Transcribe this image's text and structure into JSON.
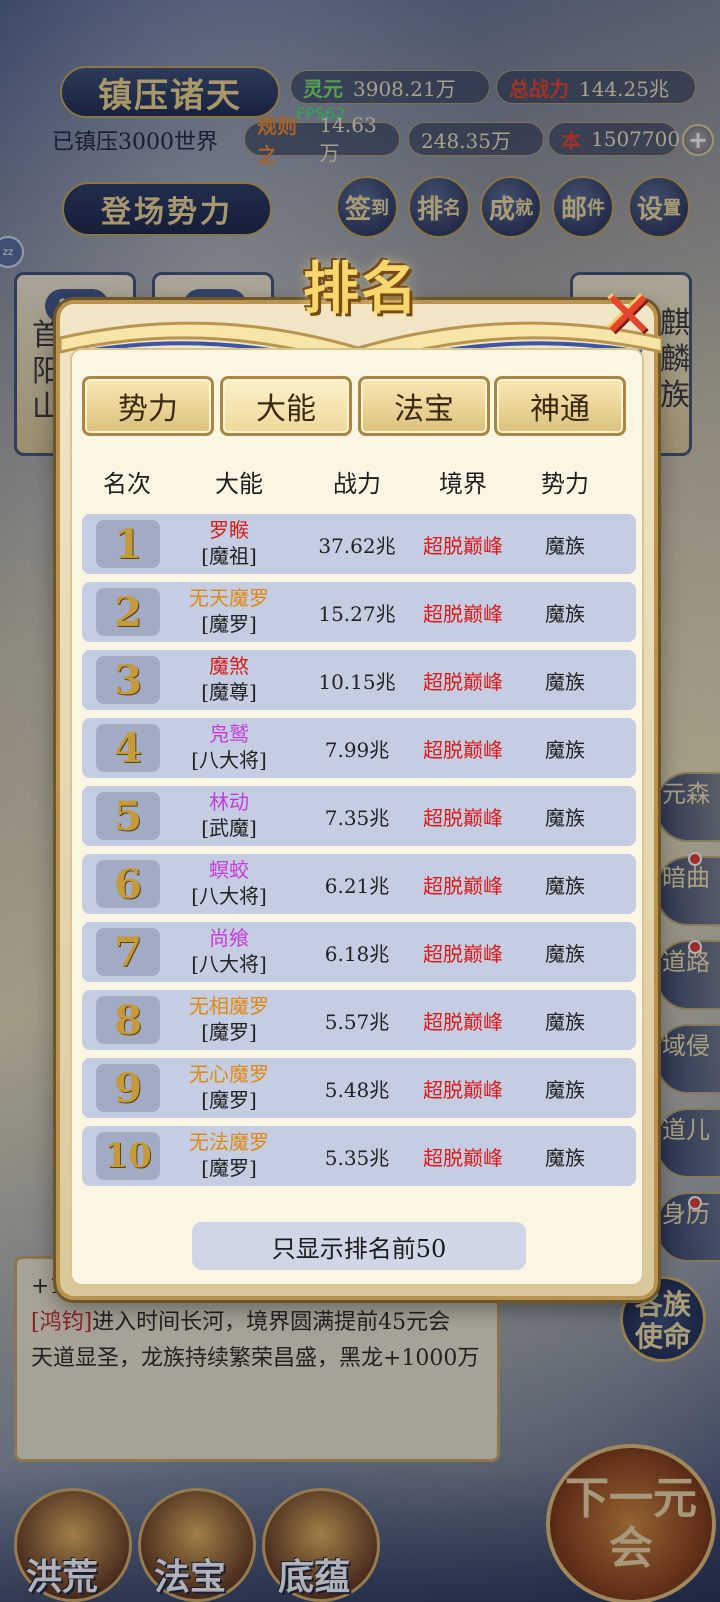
{
  "hud": {
    "title": "镇压诸天",
    "conquered": "已镇压3000世界",
    "fps": "FPS62",
    "spirit_label": "灵元",
    "spirit_value": "3908.21万",
    "total_power_label": "总战力",
    "total_power_value": "144.25兆",
    "rule_label": "规则之",
    "rule_value": "14.63万",
    "res2_value": "248.35万",
    "res3_label": "本",
    "res3_value": "1507700",
    "enter_label": "登场势力",
    "menu": [
      {
        "main": "签",
        "sub": "到"
      },
      {
        "main": "排",
        "sub": "名"
      },
      {
        "main": "成",
        "sub": "就"
      },
      {
        "main": "邮",
        "sub": "件"
      },
      {
        "main": "设",
        "sub": "置"
      }
    ],
    "chat_badge": "zz"
  },
  "background": {
    "left_text": "首阳山",
    "right_text": "麒麟族",
    "card_dots": "•••",
    "side_menu": [
      "元森",
      "暗曲",
      "道路",
      "域侵",
      "道儿",
      "身历"
    ],
    "mission_label": "各族使命",
    "log_lines": [
      {
        "prefix": "+10",
        "text": ""
      },
      {
        "prefix": "[鸿钧]",
        "text": "进入时间长河，境界圆满提前45元会"
      },
      {
        "prefix": "",
        "text": "天道显圣，龙族持续繁荣昌盛，黑龙+1000万"
      }
    ],
    "bottom_nav": [
      "洪荒",
      "法宝",
      "底蕴"
    ],
    "next_era": "下一元会"
  },
  "dialog": {
    "title": "排名",
    "close_icon": "close-x-icon",
    "tabs": [
      "势力",
      "大能",
      "法宝",
      "神通"
    ],
    "active_tab": "大能",
    "columns": [
      "名次",
      "大能",
      "战力",
      "境界",
      "势力"
    ],
    "rows": [
      {
        "rank": "1",
        "name": "罗睺",
        "title": "[魔祖]",
        "power": "37.62兆",
        "realm": "超脱巅峰",
        "faction": "魔族",
        "color": "#d61d1d"
      },
      {
        "rank": "2",
        "name": "无天魔罗",
        "title": "[魔罗]",
        "power": "15.27兆",
        "realm": "超脱巅峰",
        "faction": "魔族",
        "color": "#e08a12"
      },
      {
        "rank": "3",
        "name": "魔煞",
        "title": "[魔尊]",
        "power": "10.15兆",
        "realm": "超脱巅峰",
        "faction": "魔族",
        "color": "#d61d1d"
      },
      {
        "rank": "4",
        "name": "凫鹫",
        "title": "[八大将]",
        "power": "7.99兆",
        "realm": "超脱巅峰",
        "faction": "魔族",
        "color": "#c83adb"
      },
      {
        "rank": "5",
        "name": "林动",
        "title": "[武魔]",
        "power": "7.35兆",
        "realm": "超脱巅峰",
        "faction": "魔族",
        "color": "#c83adb"
      },
      {
        "rank": "6",
        "name": "螟蛟",
        "title": "[八大将]",
        "power": "6.21兆",
        "realm": "超脱巅峰",
        "faction": "魔族",
        "color": "#c83adb"
      },
      {
        "rank": "7",
        "name": "尚飨",
        "title": "[八大将]",
        "power": "6.18兆",
        "realm": "超脱巅峰",
        "faction": "魔族",
        "color": "#c83adb"
      },
      {
        "rank": "8",
        "name": "无相魔罗",
        "title": "[魔罗]",
        "power": "5.57兆",
        "realm": "超脱巅峰",
        "faction": "魔族",
        "color": "#e08a12"
      },
      {
        "rank": "9",
        "name": "无心魔罗",
        "title": "[魔罗]",
        "power": "5.48兆",
        "realm": "超脱巅峰",
        "faction": "魔族",
        "color": "#e08a12"
      },
      {
        "rank": "10",
        "name": "无法魔罗",
        "title": "[魔罗]",
        "power": "5.35兆",
        "realm": "超脱巅峰",
        "faction": "魔族",
        "color": "#e08a12"
      }
    ],
    "footer": "只显示排名前50"
  }
}
